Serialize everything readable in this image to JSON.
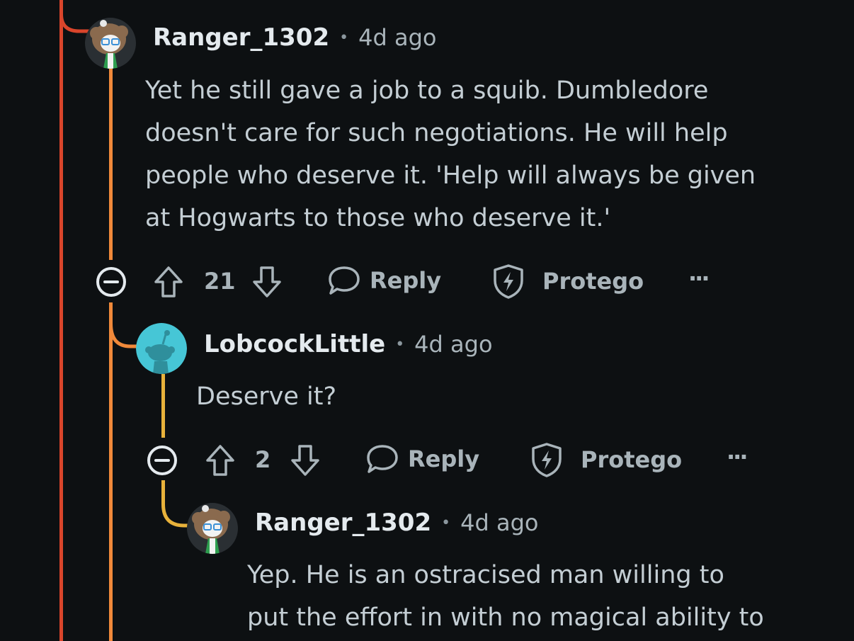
{
  "colors": {
    "background": "#0d1012",
    "thread_red": "#d9452b",
    "thread_orange": "#f0893a",
    "thread_yellow": "#e8b23b",
    "snoo_avatar": "#46c6d6"
  },
  "comments": [
    {
      "username": "Ranger_1302",
      "separator": "•",
      "time": "4d ago",
      "avatar_icon": "bearded-snoo-avatar",
      "lines": [
        "Yet he still gave a job to a squib. Dumbledore",
        "doesn't care for such negotiations. He will help",
        "people who deserve it. 'Help will always be given",
        "at Hogwarts to those who deserve it.'"
      ],
      "votes": "21",
      "reply_label": "Reply",
      "protego_label": "Protego",
      "more_label": "···"
    },
    {
      "username": "LobcockLittle",
      "separator": "•",
      "time": "4d ago",
      "avatar_icon": "default-snoo-avatar",
      "lines": [
        "Deserve it?"
      ],
      "votes": "2",
      "reply_label": "Reply",
      "protego_label": "Protego",
      "more_label": "···"
    },
    {
      "username": "Ranger_1302",
      "separator": "•",
      "time": "4d ago",
      "avatar_icon": "bearded-snoo-avatar",
      "lines": [
        "Yep. He is an ostracised man willing to",
        "put the effort in with no magical ability to"
      ]
    }
  ]
}
